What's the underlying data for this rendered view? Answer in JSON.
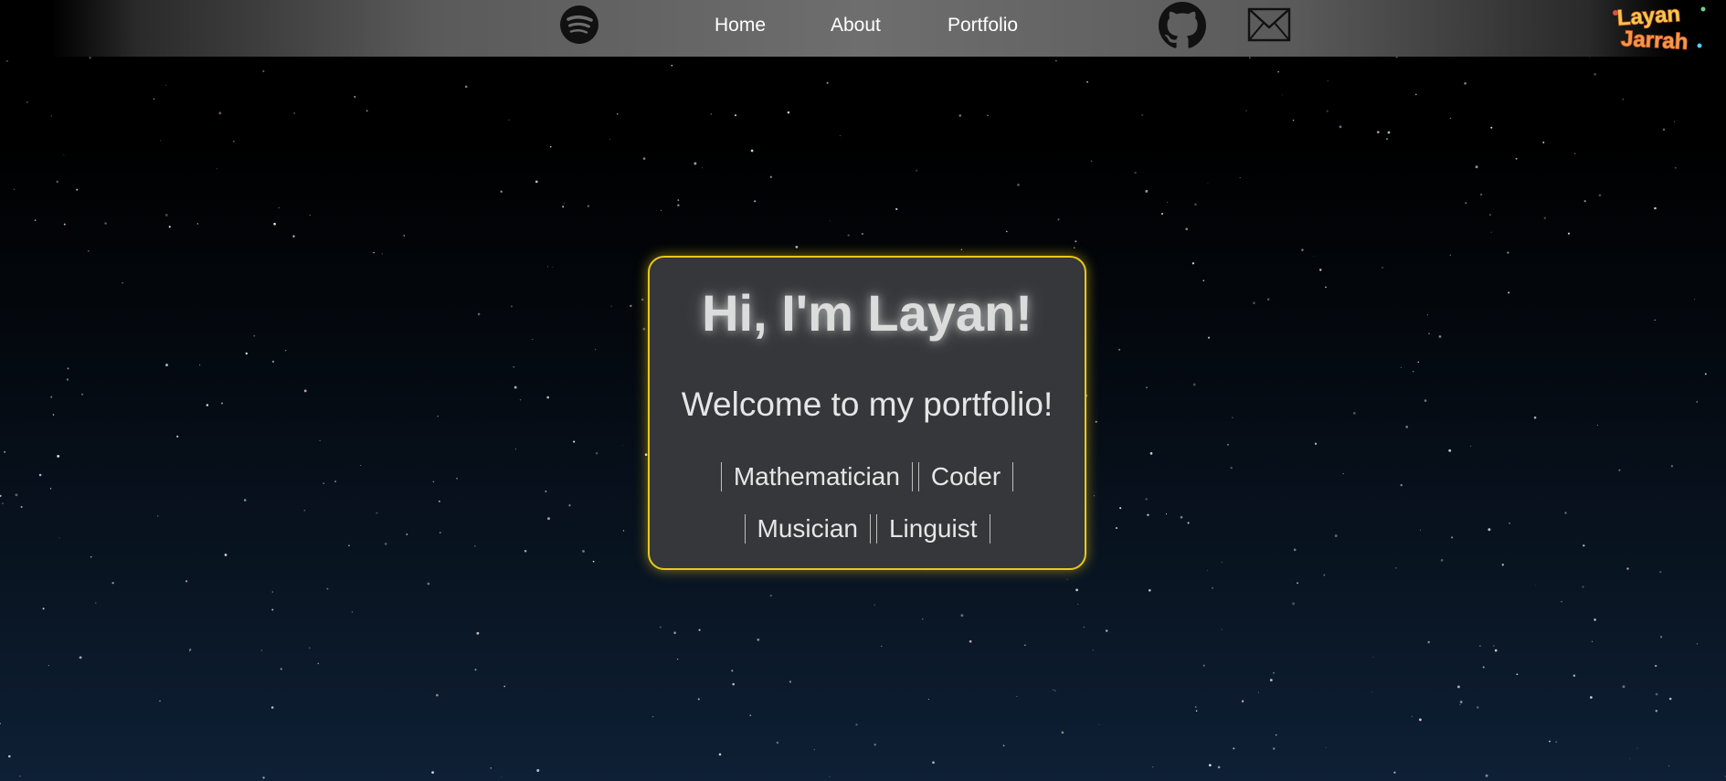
{
  "nav": {
    "icons": {
      "spotify": "spotify-icon",
      "github": "github-icon",
      "mail": "mail-icon"
    },
    "links": [
      {
        "label": "Home"
      },
      {
        "label": "About"
      },
      {
        "label": "Portfolio"
      }
    ]
  },
  "logo": {
    "text_line1": "Layan",
    "text_line2": "Jarrah"
  },
  "hero": {
    "title": "Hi, I'm Layan!",
    "subtitle": "Welcome to my portfolio!",
    "roles": [
      "Mathematician",
      "Coder",
      "Musician",
      "Linguist"
    ]
  },
  "colors": {
    "card_border": "#e8c81c",
    "card_background": "#35373a",
    "text": "#e6e6e6"
  }
}
